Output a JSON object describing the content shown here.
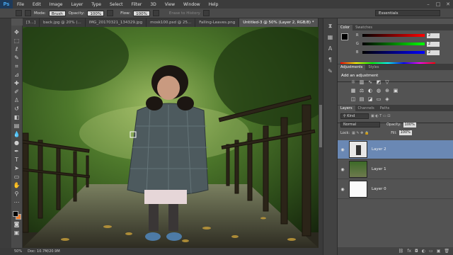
{
  "app": {
    "logo": "Ps"
  },
  "menu": [
    "File",
    "Edit",
    "Image",
    "Layer",
    "Type",
    "Select",
    "Filter",
    "3D",
    "View",
    "Window",
    "Help"
  ],
  "options": {
    "mode_label": "Mode:",
    "mode_value": "Brush",
    "opacity_label": "Opacity:",
    "opacity_value": "100%",
    "flow_label": "Flow:",
    "flow_value": "100%",
    "erase_history": "Erase to History",
    "workspace": "Essentials"
  },
  "tabs": [
    {
      "label": "[3...]"
    },
    {
      "label": "back.jpg @ 20% (..."
    },
    {
      "label": "IMG_20170321_134329.jpg"
    },
    {
      "label": "mosk100.psd @ 25..."
    },
    {
      "label": "Falling-Leaves.png"
    },
    {
      "label": "Untitled-3 @ 50% (Layer 2, RGB/8) *",
      "active": true
    }
  ],
  "status": {
    "zoom": "50%",
    "doc": "Doc: 10.7M/20.9M"
  },
  "color_panel": {
    "tabs": [
      "Color",
      "Swatches"
    ],
    "channels": [
      {
        "name": "R",
        "value": "2"
      },
      {
        "name": "G",
        "value": "2"
      },
      {
        "name": "B",
        "value": "2"
      }
    ]
  },
  "adjustments": {
    "tabs": [
      "Adjustments",
      "Styles"
    ],
    "title": "Add an adjustment"
  },
  "layers": {
    "tabs": [
      "Layers",
      "Channels",
      "Paths"
    ],
    "kind": "Kind",
    "blend": "Normal",
    "opacity_label": "Opacity:",
    "opacity_value": "100%",
    "lock_label": "Lock:",
    "fill_label": "Fill:",
    "fill_value": "100%",
    "items": [
      {
        "name": "Layer 2",
        "selected": true
      },
      {
        "name": "Layer 1",
        "selected": false
      },
      {
        "name": "Layer 0",
        "selected": false
      }
    ]
  }
}
